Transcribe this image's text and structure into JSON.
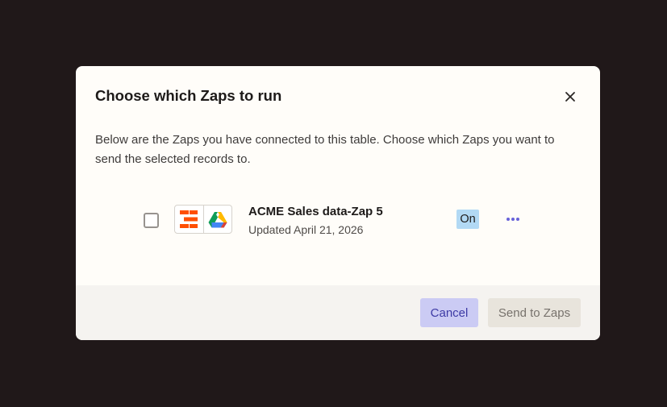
{
  "modal": {
    "title": "Choose which Zaps to run",
    "close_icon": "close-icon",
    "description": "Below are the Zaps you have connected to this table. Choose which Zaps you want to send the selected records to."
  },
  "zaps": [
    {
      "name": "ACME Sales data-Zap 5",
      "updated": "Updated April 21, 2026",
      "status": "On",
      "checked": false,
      "apps": [
        "zapier-tables-icon",
        "google-drive-icon"
      ],
      "more_icon": "more-horizontal-icon"
    }
  ],
  "footer": {
    "cancel_label": "Cancel",
    "send_label": "Send to Zaps"
  },
  "colors": {
    "backdrop": "#201819",
    "modal_bg": "#fffdf9",
    "footer_bg": "#f5f3f0",
    "status_badge": "#b2d9f4",
    "cancel_bg": "#cbcbf4",
    "cancel_text": "#3d3aa5",
    "send_bg": "#e8e4dc",
    "send_text": "#77726c",
    "more_icon": "#6862d9",
    "tables_icon": "#ff4f00"
  }
}
